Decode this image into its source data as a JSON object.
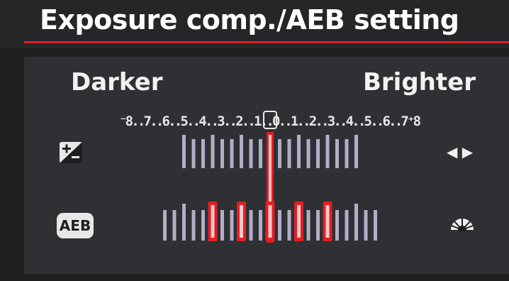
{
  "title": "Exposure comp./AEB setting",
  "labels": {
    "darker": "Darker",
    "brighter": "Brighter"
  },
  "scale": {
    "text": "⁻8..7..6..5..4..3..2..1..0..1..2..3..4..5..6..7⁺8",
    "min": -8,
    "max": 8,
    "steps_per_stop": 3
  },
  "exposure_compensation": {
    "icon": "exposure-compensation-icon",
    "value": 0
  },
  "aeb": {
    "label": "AEB",
    "icon": "aeb-icon",
    "markers": [
      -2,
      -1,
      0,
      1,
      2
    ]
  },
  "controls": {
    "arrows": "◀ ▶",
    "dial_icon": "main-dial-icon"
  },
  "colors": {
    "accent": "#e31e24",
    "tick": "#b3adc9",
    "text": "#f2f2f2"
  }
}
